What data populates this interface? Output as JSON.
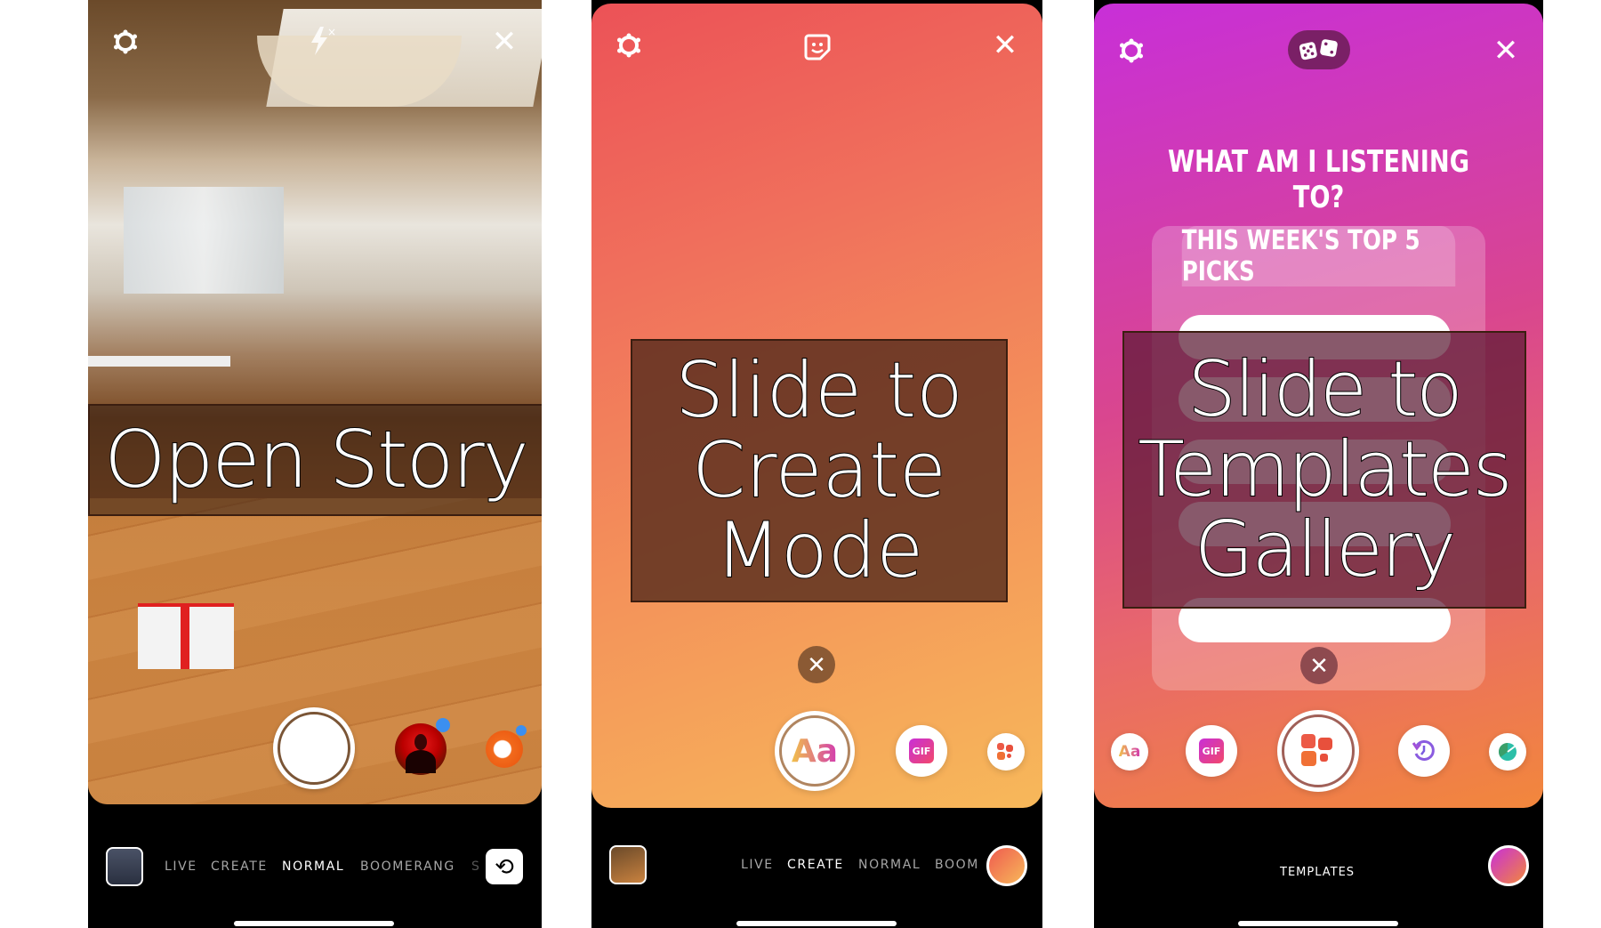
{
  "panels": [
    {
      "name": "camera",
      "overlay_caption": "Open Story",
      "top_icons": [
        "gear-icon",
        "flash-off-icon",
        "close-icon"
      ],
      "close_glyph": "✕",
      "flash_badge": "×",
      "modes": [
        "LIVE",
        "CREATE",
        "NORMAL",
        "BOOMERANG",
        "S"
      ],
      "active_mode": "NORMAL",
      "flip_glyph": "⟲"
    },
    {
      "name": "create-mode",
      "overlay_caption": "Slide to Create Mode",
      "top_icons": [
        "gear-icon",
        "sticker-icon",
        "close-icon"
      ],
      "close_glyph": "✕",
      "dismiss_glyph": "✕",
      "tools": [
        {
          "label": "Aa",
          "name": "text-tool"
        },
        {
          "label": "GIF",
          "name": "gif-tool"
        },
        {
          "label": "",
          "name": "templates-tool"
        }
      ],
      "modes": [
        "LIVE",
        "CREATE",
        "NORMAL",
        "BOOM"
      ],
      "active_mode": "CREATE",
      "color_accent": "#f07a4a"
    },
    {
      "name": "templates-gallery",
      "overlay_caption": "Slide to Templates Gallery",
      "top_icons": [
        "gear-icon",
        "dice-icon",
        "close-icon"
      ],
      "close_glyph": "✕",
      "dismiss_glyph": "✕",
      "template_title": "WHAT AM I LISTENING TO?",
      "template_card_header": "THIS WEEK'S TOP 5 PICKS",
      "tools": [
        {
          "label": "Aa",
          "name": "text-tool"
        },
        {
          "label": "GIF",
          "name": "gif-tool"
        },
        {
          "label": "",
          "name": "templates-tool"
        },
        {
          "label": "",
          "name": "memories-tool"
        },
        {
          "label": "",
          "name": "poll-tool"
        }
      ],
      "active_mode": "TEMPLATES",
      "color_accent": "#d04bb0"
    }
  ]
}
